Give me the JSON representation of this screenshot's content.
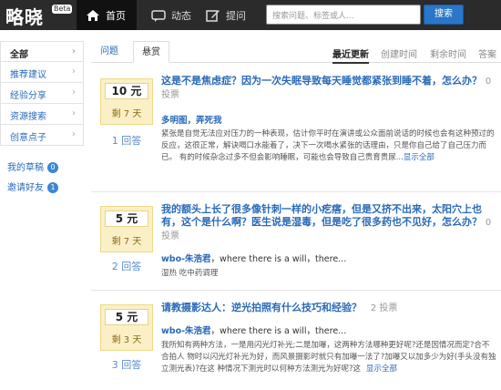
{
  "header": {
    "logo": "略晓",
    "beta": "Beta",
    "nav": [
      {
        "label": "首页",
        "icon": "home-icon"
      },
      {
        "label": "动态",
        "icon": "chat-icon"
      },
      {
        "label": "提问",
        "icon": "edit-icon"
      }
    ],
    "search_placeholder": "搜索问题、标签或人...",
    "search_button": "搜索"
  },
  "sidebar": {
    "items": [
      {
        "label": "全部"
      },
      {
        "label": "推荐建议"
      },
      {
        "label": "经验分享"
      },
      {
        "label": "资源搜索"
      },
      {
        "label": "创意点子"
      }
    ],
    "links": [
      {
        "label": "我的草稿",
        "count": "0"
      },
      {
        "label": "邀请好友",
        "count": "1"
      }
    ]
  },
  "tabs": {
    "items": [
      "问题",
      "悬赏"
    ],
    "active": "悬赏"
  },
  "sort": {
    "items": [
      "最近更新",
      "创建时间",
      "剩余时间",
      "答案"
    ],
    "active": "最近更新"
  },
  "questions": [
    {
      "amount": "10 元",
      "days": "剩 7 天",
      "answers": "1 回答",
      "title": "这是不是焦虑症？因为一次失眠导致每天睡觉都紧张到睡不着，怎么办？",
      "votes": "0 投票",
      "author": "多明图，弄死我",
      "author_tail": "",
      "body": "紧张是自觉无法应对压力的一种表现，估计你平时在演讲或公众面前说话的时候也会有这种预过的反应，这很正常，解诀喝口水能着了，决下一次喝水紧张的话理由，只是你自己给了自己压力而已。 有的时候杂念过多不但会影响睡眠，可能也会导致自己贵育贵尿",
      "more": "...显示全部"
    },
    {
      "amount": "5 元",
      "days": "剩 7 天",
      "answers": "2 回答",
      "title": "我的额头上长了很多像针刺一样的小疙瘩，但是又挤不出来，太阳穴上也有，这个是什么啊？医生说是湿毒，但是吃了很多药也不见好，怎么办？",
      "votes": "0 投票",
      "author": "wbo-朱浩君",
      "author_tail": "，where there is a will，there...",
      "body": "湿热 吃中药调理",
      "more": ""
    },
    {
      "amount": "5 元",
      "days": "剩 3 天",
      "answers": "3 回答",
      "title": "请教摄影达人：逆光拍照有什么技巧和经验？",
      "votes": "2 投票",
      "author": "wbo-朱浩君",
      "author_tail": "，where there is a will，there...",
      "body": "我所知有两种方法，一是用闪光灯补光;二是加曝，这两种方法哪种更好呢?还是因情况而定?合不合拍人 物时以闪光灯补光为好，而风景摄影时就只有加曝一法了?加曝又以加多少为好(手头没有独立测光表)?在这 种情况下测光时以何种方法测光为好呢?这",
      "more": "显示全部"
    }
  ],
  "colors": {
    "accent": "#2a6ab8",
    "topbar": "#2b2b2b",
    "bounty_bg": "#fbf0c5"
  }
}
